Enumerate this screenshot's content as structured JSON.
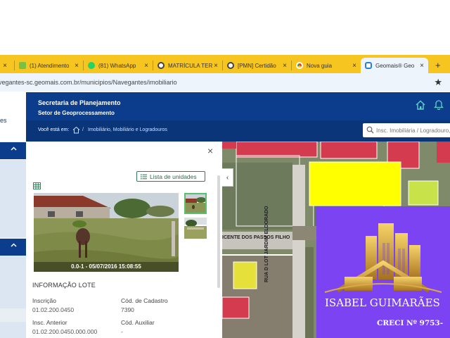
{
  "browser": {
    "tabs": [
      {
        "icon": "partial-icon",
        "title": "s",
        "active": false
      },
      {
        "icon": "puzzle-icon",
        "title": "(1) Atendimento",
        "active": false
      },
      {
        "icon": "whatsapp-icon",
        "title": "(81) WhatsApp",
        "active": false
      },
      {
        "icon": "globe-icon",
        "title": "MATRÍCULA TER",
        "active": false
      },
      {
        "icon": "globe-icon",
        "title": "[PMN] Certidão",
        "active": false
      },
      {
        "icon": "chrome-icon",
        "title": "Nova guia",
        "active": false
      },
      {
        "icon": "geomais-icon",
        "title": "Geomais® Geo",
        "active": true
      }
    ],
    "new_tab": "+",
    "url": "vegantes-sc.geomais.com.br/municipios/Navegantes/imobiliario",
    "star": "★",
    "close_glyph": "×"
  },
  "header": {
    "title": "Secretaria de Planejamento",
    "subtitle": "Setor de Geoprocessamento"
  },
  "breadcrumb": {
    "label": "Você está em:",
    "separator": "/",
    "link": "Imobiliário, Mobiliário e Logradouros"
  },
  "search": {
    "placeholder": "Insc. Imobiliária / Logradouro, N"
  },
  "leftnav": {
    "partial_text": "es"
  },
  "panel": {
    "close": "×",
    "lista_label": "Lista de unidades",
    "photo_caption": "0.0-1 - 05/07/2016 15:08:55",
    "section_title": "INFORMAÇÃO LOTE",
    "fields": [
      {
        "label": "Inscrição",
        "value": "01.02.200.0450"
      },
      {
        "label": "Cód. de Cadastro",
        "value": "7390"
      },
      {
        "label": "Insc. Anterior",
        "value": "01.02.200.0450.000.000"
      },
      {
        "label": "Cód. Auxiliar",
        "value": "-"
      }
    ]
  },
  "map": {
    "street_1": "ICENTE DOS PASSOS FILHO",
    "street_2": "RUA D LOT JARDIM ELDORADO",
    "collapse": "‹"
  },
  "banner": {
    "name": "ISABEL GUIMARÃES",
    "creci": "CRECI Nº 9753-"
  },
  "colors": {
    "tabbar": "#f7c520",
    "header": "#0b3d8c",
    "highlight_lot": "#ffff00",
    "banner": "#7b43f2"
  }
}
